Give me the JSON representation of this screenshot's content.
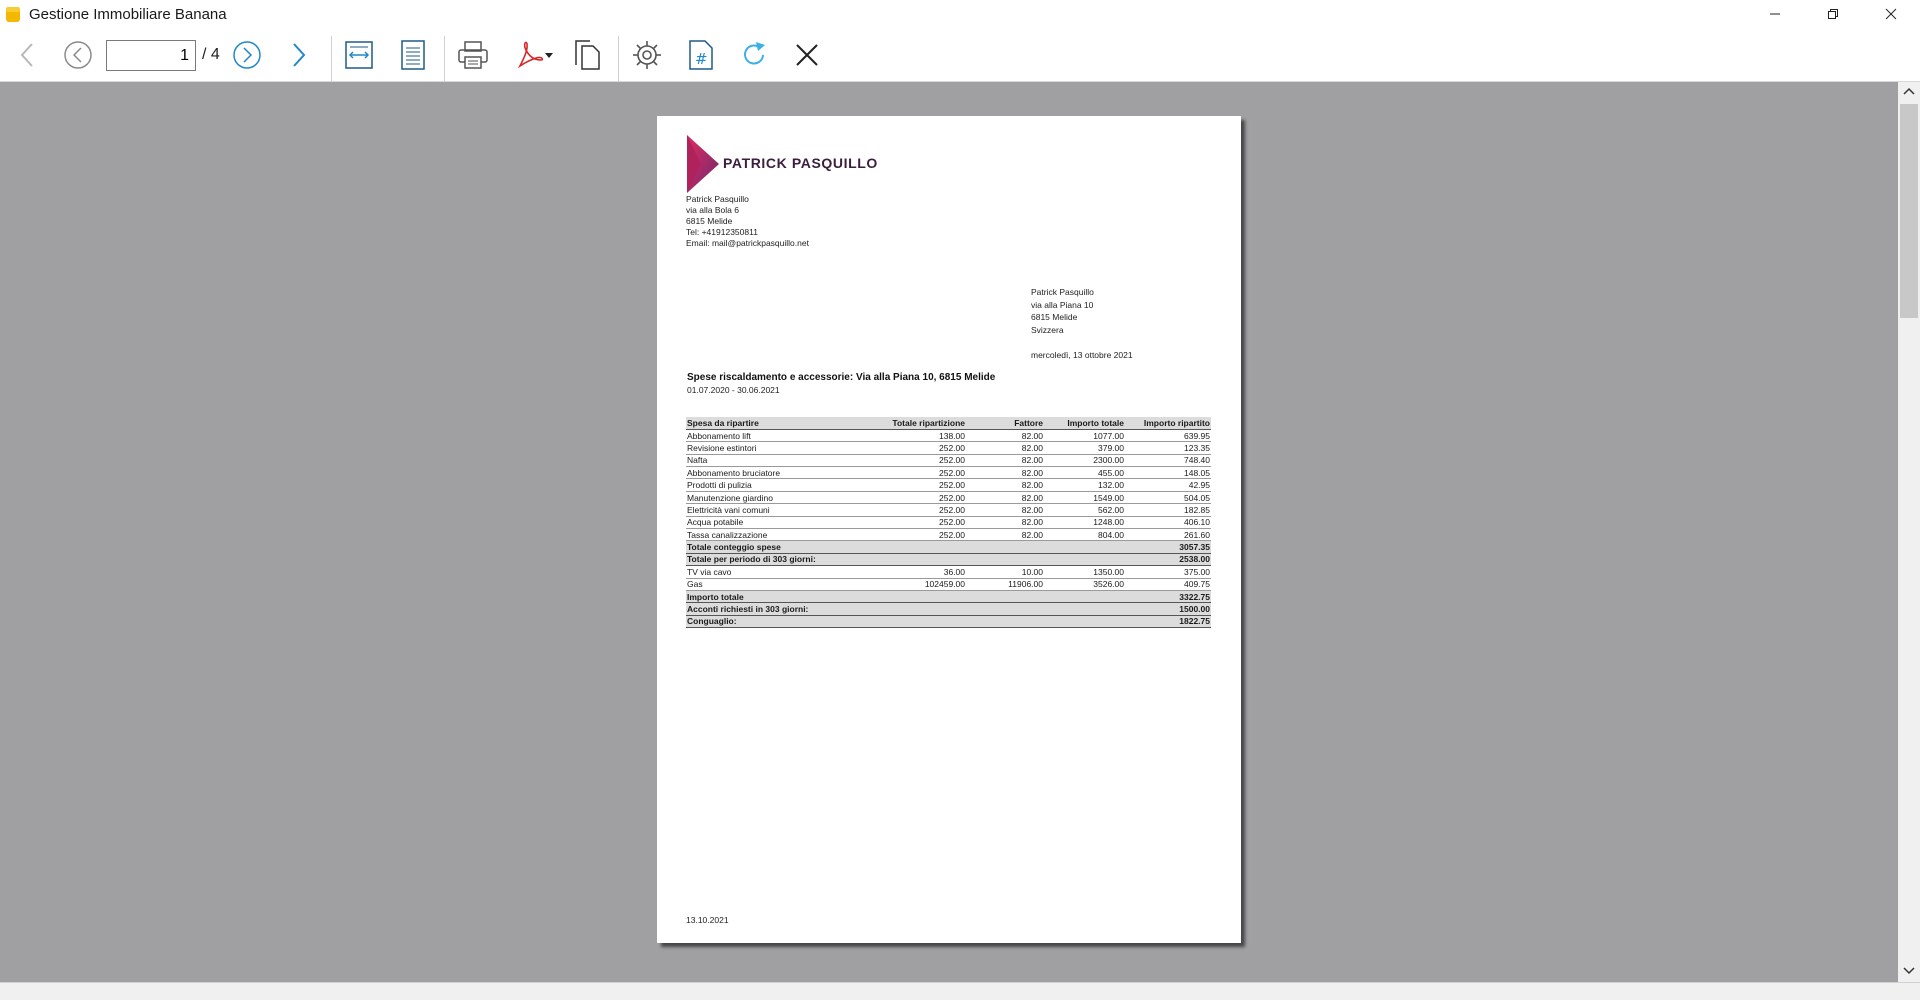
{
  "window": {
    "title": "Gestione Immobiliare Banana",
    "colors": {
      "accent": "#1e88c8",
      "logo": "#c0245a",
      "viewer_bg": "#a0a0a2"
    }
  },
  "toolbar": {
    "page_value": "1",
    "page_total": "/ 4",
    "icons": [
      "back-icon",
      "previous-page-icon",
      "next-page-icon",
      "forward-icon",
      "fit-width-icon",
      "fit-page-icon",
      "print-icon",
      "pdf-icon",
      "copy-icon",
      "settings-icon",
      "page-number-icon",
      "refresh-icon",
      "close-icon"
    ]
  },
  "document": {
    "logo_text": "PATRICK PASQUILLO",
    "sender": [
      "Patrick Pasquillo",
      "via alla Bola 6",
      "6815 Melide",
      "Tel: +41912350811",
      "Email: mail@patrickpasquillo.net"
    ],
    "recipient": [
      "Patrick Pasquillo",
      "via alla Piana 10",
      "6815 Melide",
      "Svizzera"
    ],
    "date": "mercoledì, 13 ottobre 2021",
    "title": "Spese riscaldamento e accessorie: Via alla Piana 10, 6815 Melide",
    "period": "01.07.2020 - 30.06.2021",
    "table": {
      "headers": [
        "Spesa da ripartire",
        "Totale ripartizione",
        "Fattore",
        "Importo totale",
        "Importo ripartito"
      ],
      "rows": [
        {
          "cells": [
            "Abbonamento lift",
            "138.00",
            "82.00",
            "1077.00",
            "639.95"
          ],
          "total": false
        },
        {
          "cells": [
            "Revisione estintori",
            "252.00",
            "82.00",
            "379.00",
            "123.35"
          ],
          "total": false
        },
        {
          "cells": [
            "Nafta",
            "252.00",
            "82.00",
            "2300.00",
            "748.40"
          ],
          "total": false
        },
        {
          "cells": [
            "Abbonamento bruciatore",
            "252.00",
            "82.00",
            "455.00",
            "148.05"
          ],
          "total": false
        },
        {
          "cells": [
            "Prodotti di pulizia",
            "252.00",
            "82.00",
            "132.00",
            "42.95"
          ],
          "total": false
        },
        {
          "cells": [
            "Manutenzione giardino",
            "252.00",
            "82.00",
            "1549.00",
            "504.05"
          ],
          "total": false
        },
        {
          "cells": [
            "Elettricità vani comuni",
            "252.00",
            "82.00",
            "562.00",
            "182.85"
          ],
          "total": false
        },
        {
          "cells": [
            "Acqua potabile",
            "252.00",
            "82.00",
            "1248.00",
            "406.10"
          ],
          "total": false
        },
        {
          "cells": [
            "Tassa canalizzazione",
            "252.00",
            "82.00",
            "804.00",
            "261.60"
          ],
          "total": false
        },
        {
          "cells": [
            "Totale conteggio spese",
            "",
            "",
            "",
            "3057.35"
          ],
          "total": true
        },
        {
          "cells": [
            "Totale per periodo di 303 giorni:",
            "",
            "",
            "",
            "2538.00"
          ],
          "total": true
        },
        {
          "cells": [
            "TV via cavo",
            "36.00",
            "10.00",
            "1350.00",
            "375.00"
          ],
          "total": false
        },
        {
          "cells": [
            "Gas",
            "102459.00",
            "11906.00",
            "3526.00",
            "409.75"
          ],
          "total": false
        },
        {
          "cells": [
            "Importo totale",
            "",
            "",
            "",
            "3322.75"
          ],
          "total": true
        },
        {
          "cells": [
            "Acconti richiesti in 303 giorni:",
            "",
            "",
            "",
            "1500.00"
          ],
          "total": true
        },
        {
          "cells": [
            "Conguaglio:",
            "",
            "",
            "",
            "1822.75"
          ],
          "total": true
        }
      ]
    },
    "footer_date": "13.10.2021"
  }
}
